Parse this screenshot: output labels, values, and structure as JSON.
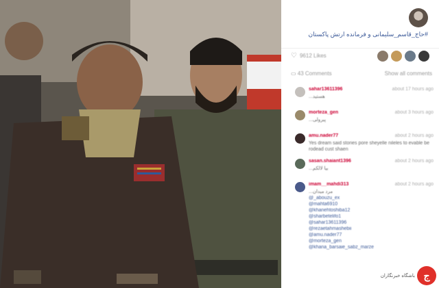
{
  "caption": "#حاج_قاسم_سلیمانی و فرمانده ارتش پاکستان",
  "likes_text": "9612 Likes",
  "comments_count": "43 Comments",
  "show_all": "Show all comments",
  "comments": [
    {
      "user": "sahar13611396",
      "time": "about 17 hours ago",
      "body": "...هستید"
    },
    {
      "user": "morteza_gen",
      "time": "about 3 hours ago",
      "body": "...پبرولی"
    },
    {
      "user": "amu.nader77",
      "time": "about 2 hours ago",
      "body": "Yes dream said stories pore sheyelle nileles to evable be rodead cust shaen"
    },
    {
      "user": "sasan.shaiant1396",
      "time": "about 2 hours ago",
      "body": "...بیا لالکم"
    },
    {
      "user": "imam__mahdi313",
      "time": "about 2 hours ago",
      "body": "...مرد میدان",
      "mentions": [
        "@_abouzu_ex",
        "@mahta6910",
        "@khanehtoshiba12",
        "@sharbetelifo1",
        "@sahar13611396",
        "@rezaetahmashebii",
        "@amu.nader77",
        "@morteza_gen",
        "@khana_barsaie_sabz_marze"
      ]
    }
  ],
  "logo_text": "باشگاه خبرنگاران",
  "colors": {
    "link": "#3b5998",
    "username": "#cc0033",
    "logo": "#e0302a"
  }
}
